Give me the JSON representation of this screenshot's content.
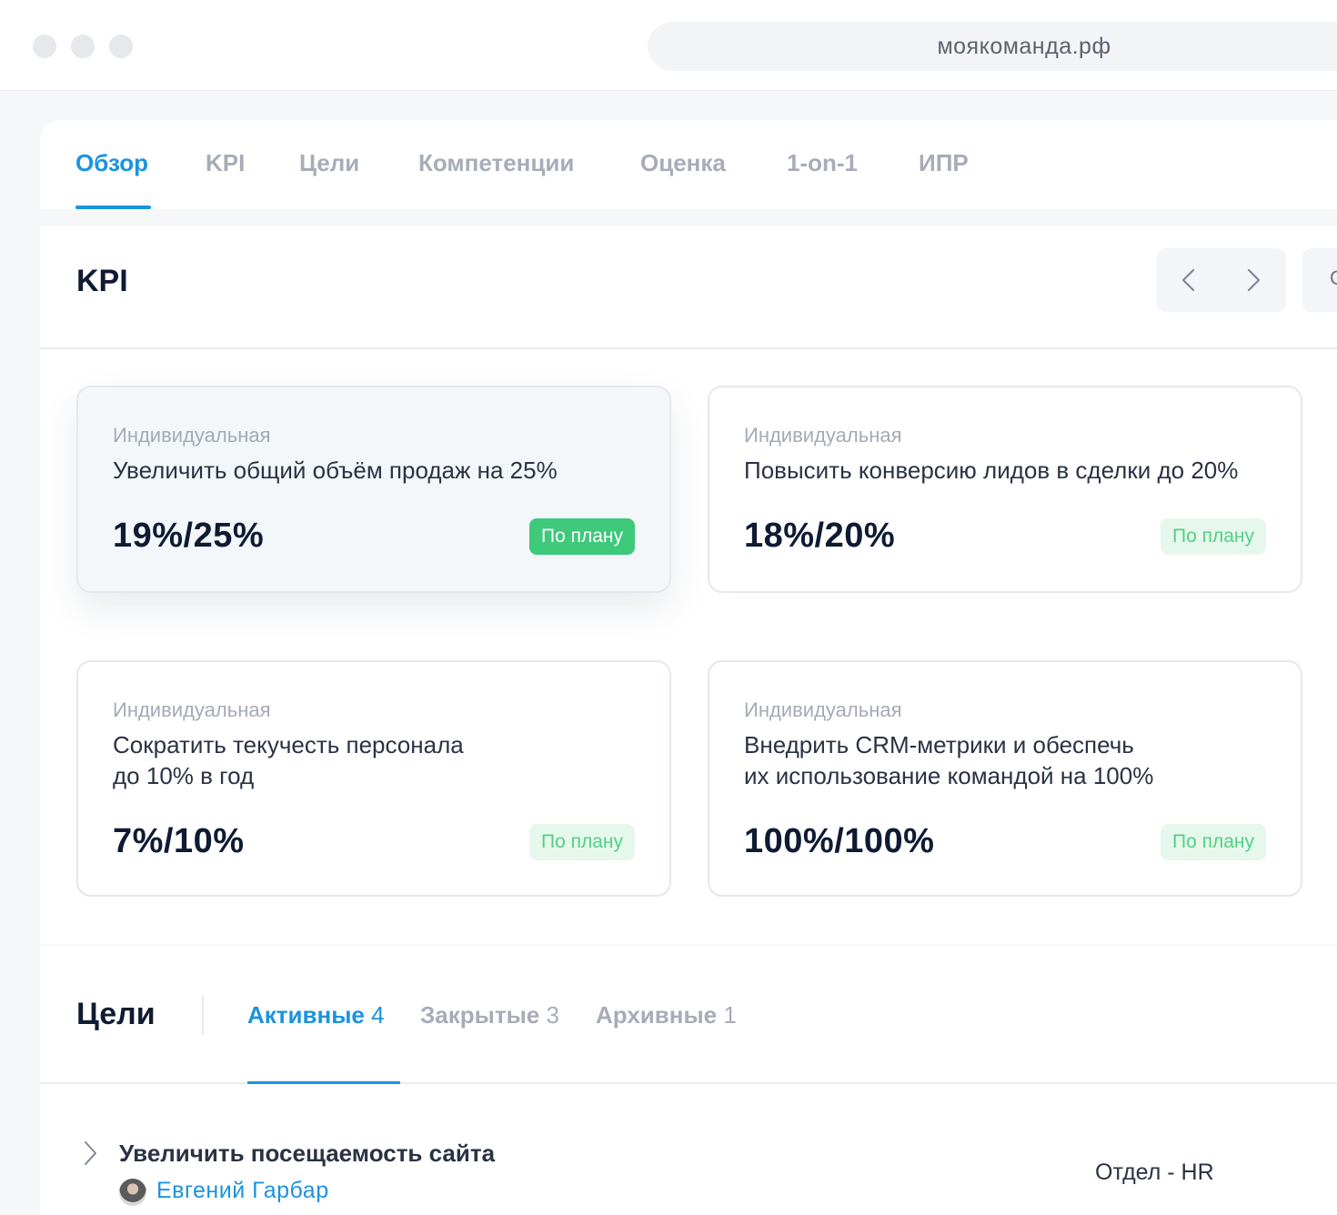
{
  "browser": {
    "url": "моякоманда.рф"
  },
  "tabs": [
    {
      "label": "Обзор",
      "active": true
    },
    {
      "label": "KPI"
    },
    {
      "label": "Цели"
    },
    {
      "label": "Компетенции"
    },
    {
      "label": "Оценка"
    },
    {
      "label": "1-on-1"
    },
    {
      "label": "ИПР"
    }
  ],
  "kpi": {
    "title": "KPI",
    "extra_button_label": "С",
    "cards": [
      {
        "type": "Индивидуальная",
        "title_line1": "Увеличить общий объём продаж на 25%",
        "title_line2": "",
        "value": "19%/25%",
        "status": "По плану"
      },
      {
        "type": "Индивидуальная",
        "title_line1": "Повысить конверсию лидов в сделки до 20%",
        "title_line2": "",
        "value": "18%/20%",
        "status": "По плану"
      },
      {
        "type": "Индивидуальная",
        "title_line1": "Сократить текучесть персонала",
        "title_line2": "до 10% в год",
        "value": "7%/10%",
        "status": "По плану"
      },
      {
        "type": "Индивидуальная",
        "title_line1": "Внедрить CRM-метрики и обеспечь",
        "title_line2": "их использование командой на 100%",
        "value": "100%/100%",
        "status": "По плану"
      }
    ]
  },
  "goals": {
    "title": "Цели",
    "tabs": [
      {
        "label": "Активные",
        "count": "4",
        "active": true
      },
      {
        "label": "Закрытые",
        "count": "3"
      },
      {
        "label": "Архивные",
        "count": "1"
      }
    ],
    "items": [
      {
        "name": "Увеличить посещаемость сайта",
        "owner": "Евгений  Гарбар",
        "department": "Отдел - HR"
      }
    ]
  },
  "colors": {
    "accent": "#1a93e0",
    "success": "#3ec97b",
    "success_light": "#e6f8ec"
  },
  "icons": {
    "prev": "chevron-left-icon",
    "next": "chevron-right-icon",
    "expand": "chevron-right-icon"
  }
}
